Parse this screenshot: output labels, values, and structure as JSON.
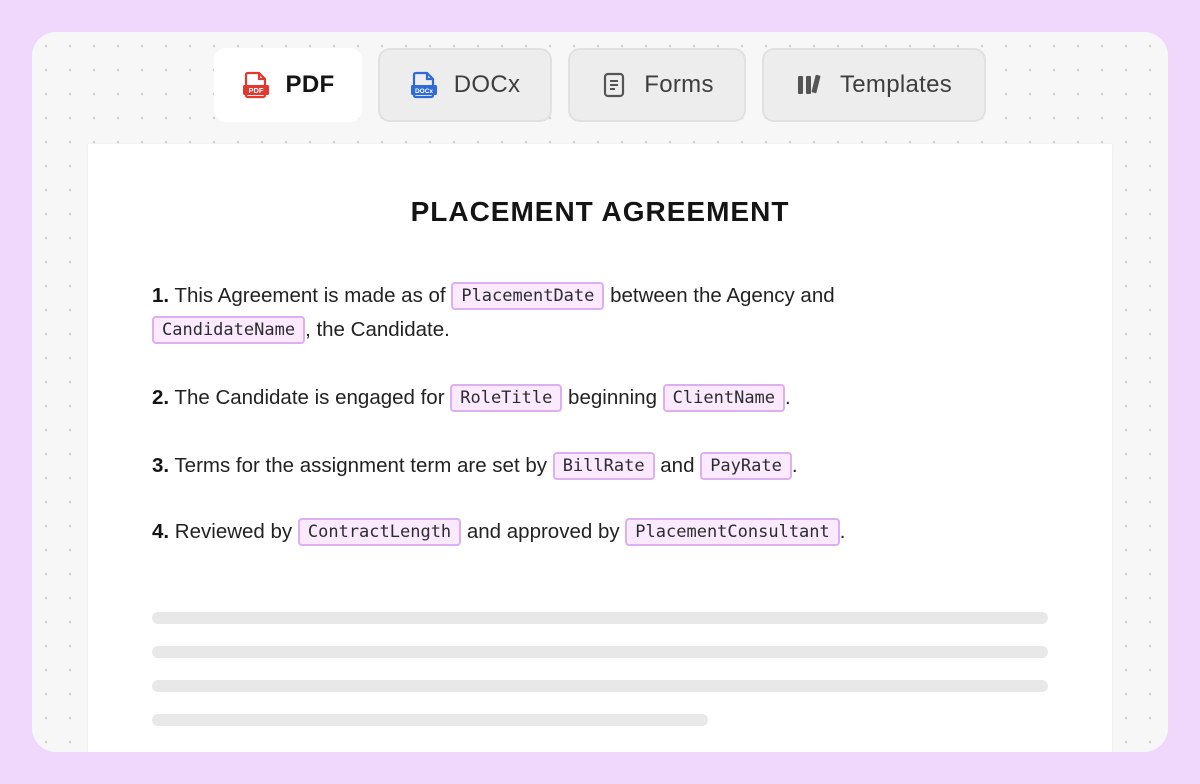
{
  "tabs": [
    {
      "label": "PDF",
      "icon": "pdf-file-icon",
      "active": true
    },
    {
      "label": "DOCx",
      "icon": "docx-file-icon",
      "active": false
    },
    {
      "label": "Forms",
      "icon": "form-document-icon",
      "active": false
    },
    {
      "label": "Templates",
      "icon": "templates-library-icon",
      "active": false
    }
  ],
  "icons": {
    "pdf_text": "PDF",
    "docx_text": "DOCx",
    "pdf_color": "#e2382f",
    "docx_color": "#2f6bd8"
  },
  "document": {
    "title": "PLACEMENT AGREEMENT",
    "clauses": [
      {
        "num": "1.",
        "t1": " This Agreement is made as of ",
        "f1": "PlacementDate",
        "t2": " between the Agency and ",
        "f2": "CandidateName",
        "t3": ", the Candidate."
      },
      {
        "num": "2.",
        "t1": " The Candidate is engaged for ",
        "f1": "RoleTitle",
        "t2": " beginning ",
        "f2": "ClientName",
        "t3": "."
      },
      {
        "num": "3.",
        "t1": " Terms for the assignment term are set by ",
        "f1": "BillRate",
        "t2": " and ",
        "f2": "PayRate",
        "t3": "."
      },
      {
        "num": "4.",
        "t1": " Reviewed by ",
        "f1": "ContractLength",
        "t2": " and approved by ",
        "f2": "PlacementConsultant",
        "t3": "."
      }
    ]
  },
  "colors": {
    "frame": "#efd8fc",
    "chip_bg": "#fbeaff",
    "chip_border": "#dcb0f0",
    "placeholder_bar": "#e8e8e8"
  }
}
